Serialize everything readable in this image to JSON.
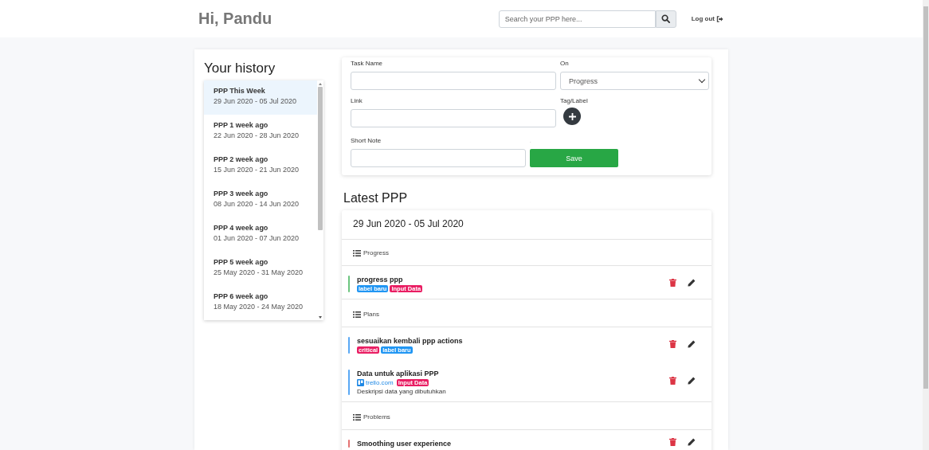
{
  "header": {
    "greeting": "Hi, Pandu",
    "search": {
      "placeholder": "Search your PPP here..."
    },
    "logout": "Log out"
  },
  "history": {
    "title": "Your history",
    "items": [
      {
        "title": "PPP This Week",
        "range": "29 Jun 2020 - 05 Jul 2020",
        "selected": true
      },
      {
        "title": "PPP 1 week ago",
        "range": "22 Jun 2020 - 28 Jun 2020",
        "selected": false
      },
      {
        "title": "PPP 2 week ago",
        "range": "15 Jun 2020 - 21 Jun 2020",
        "selected": false
      },
      {
        "title": "PPP 3 week ago",
        "range": "08 Jun 2020 - 14 Jun 2020",
        "selected": false
      },
      {
        "title": "PPP 4 week ago",
        "range": "01 Jun 2020 - 07 Jun 2020",
        "selected": false
      },
      {
        "title": "PPP 5 week ago",
        "range": "25 May 2020 - 31 May 2020",
        "selected": false
      },
      {
        "title": "PPP 6 week ago",
        "range": "18 May 2020 - 24 May 2020",
        "selected": false
      }
    ]
  },
  "form": {
    "task_name_label": "Task Name",
    "on_label": "On",
    "on_value": "Progress",
    "link_label": "Link",
    "tag_label": "Tag/Label",
    "short_note_label": "Short Note",
    "save_label": ".",
    "save_button": "Save"
  },
  "latest": {
    "title": "Latest PPP",
    "range": "29 Jun 2020 - 05 Jul 2020",
    "sections": [
      {
        "title": "Progress",
        "items": [
          {
            "name": "progress ppp",
            "color": "#6cc57f",
            "tags": [
              {
                "text": "label baru",
                "color": "#2196f3"
              },
              {
                "text": "Input Data",
                "color": "#e91e63"
              }
            ]
          }
        ]
      },
      {
        "title": "Plans",
        "items": [
          {
            "name": "sesuaikan kembali ppp actions",
            "color": "#5aa9f5",
            "tags": [
              {
                "text": "critical",
                "color": "#e91e63"
              },
              {
                "text": "label baru",
                "color": "#2196f3"
              }
            ]
          },
          {
            "name": "Data untuk aplikasi PPP",
            "color": "#5aa9f5",
            "link": "trello.com",
            "tags": [
              {
                "text": "Input Data",
                "color": "#e91e63"
              }
            ],
            "note": "Deskripsi data yang dibutuhkan"
          }
        ]
      },
      {
        "title": "Problems",
        "items": [
          {
            "name": "Smoothing user experience",
            "color": "#e57373"
          }
        ]
      }
    ]
  }
}
